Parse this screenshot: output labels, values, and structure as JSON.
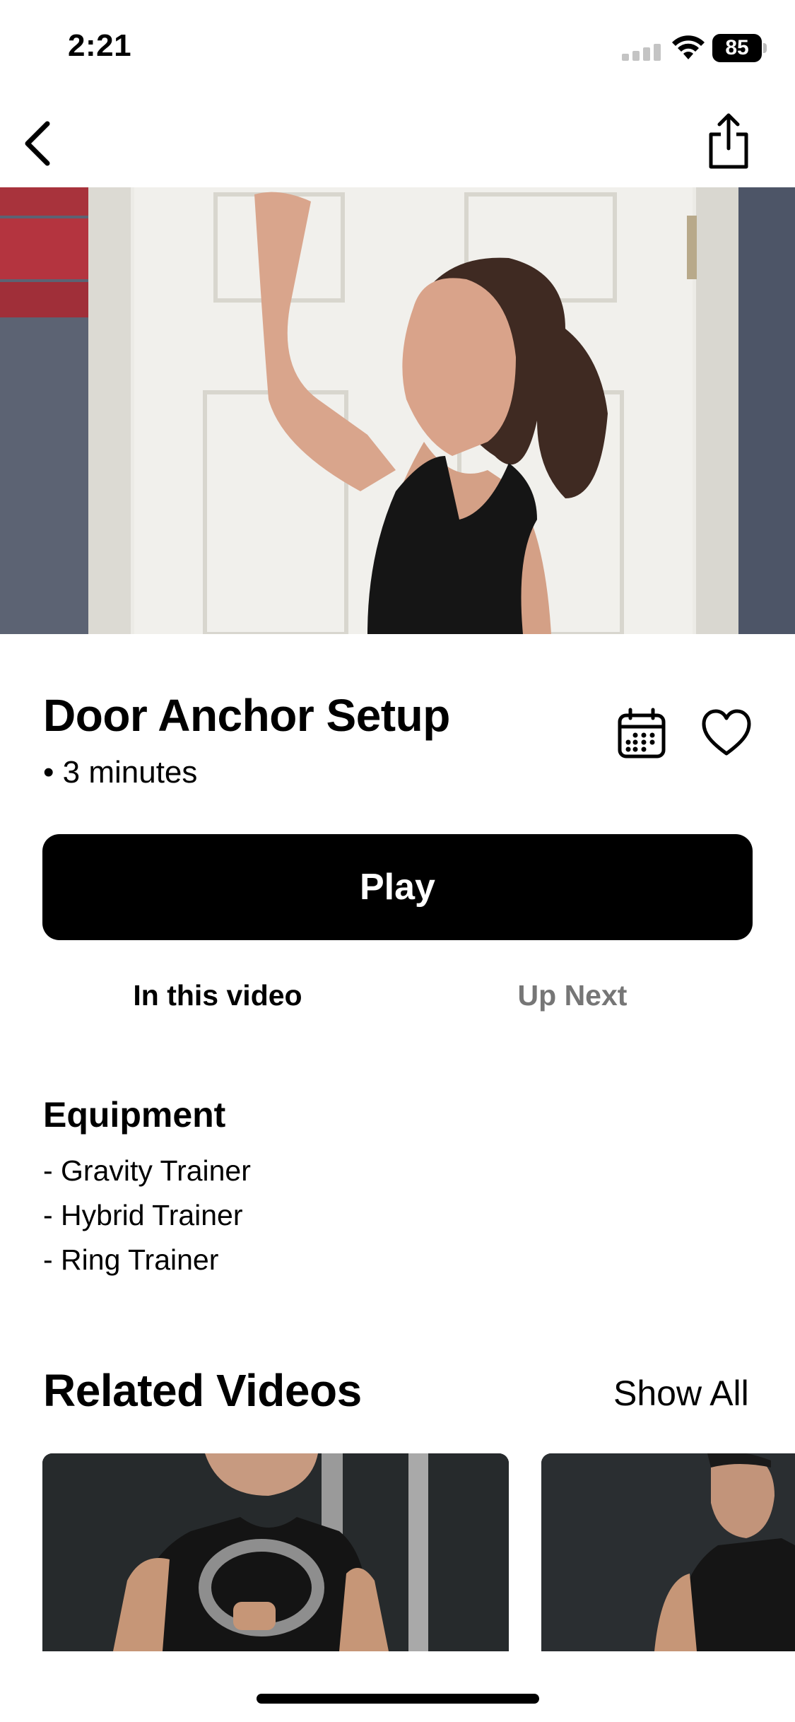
{
  "status_bar": {
    "time": "2:21",
    "battery": "85"
  },
  "video": {
    "title": "Door Anchor Setup",
    "duration": "• 3 minutes",
    "play_label": "Play"
  },
  "tabs": [
    {
      "label": "In this video",
      "active": true
    },
    {
      "label": "Up Next",
      "active": false
    }
  ],
  "equipment": {
    "heading": "Equipment",
    "items": [
      "- Gravity Trainer",
      "- Hybrid Trainer",
      "- Ring Trainer"
    ]
  },
  "related": {
    "heading": "Related Videos",
    "show_all_label": "Show All"
  },
  "icons": {
    "back": "chevron-left-icon",
    "share": "share-icon",
    "calendar": "calendar-icon",
    "favorite": "heart-icon"
  },
  "colors": {
    "accent": "#000000",
    "inactive_tab": "#767676"
  }
}
